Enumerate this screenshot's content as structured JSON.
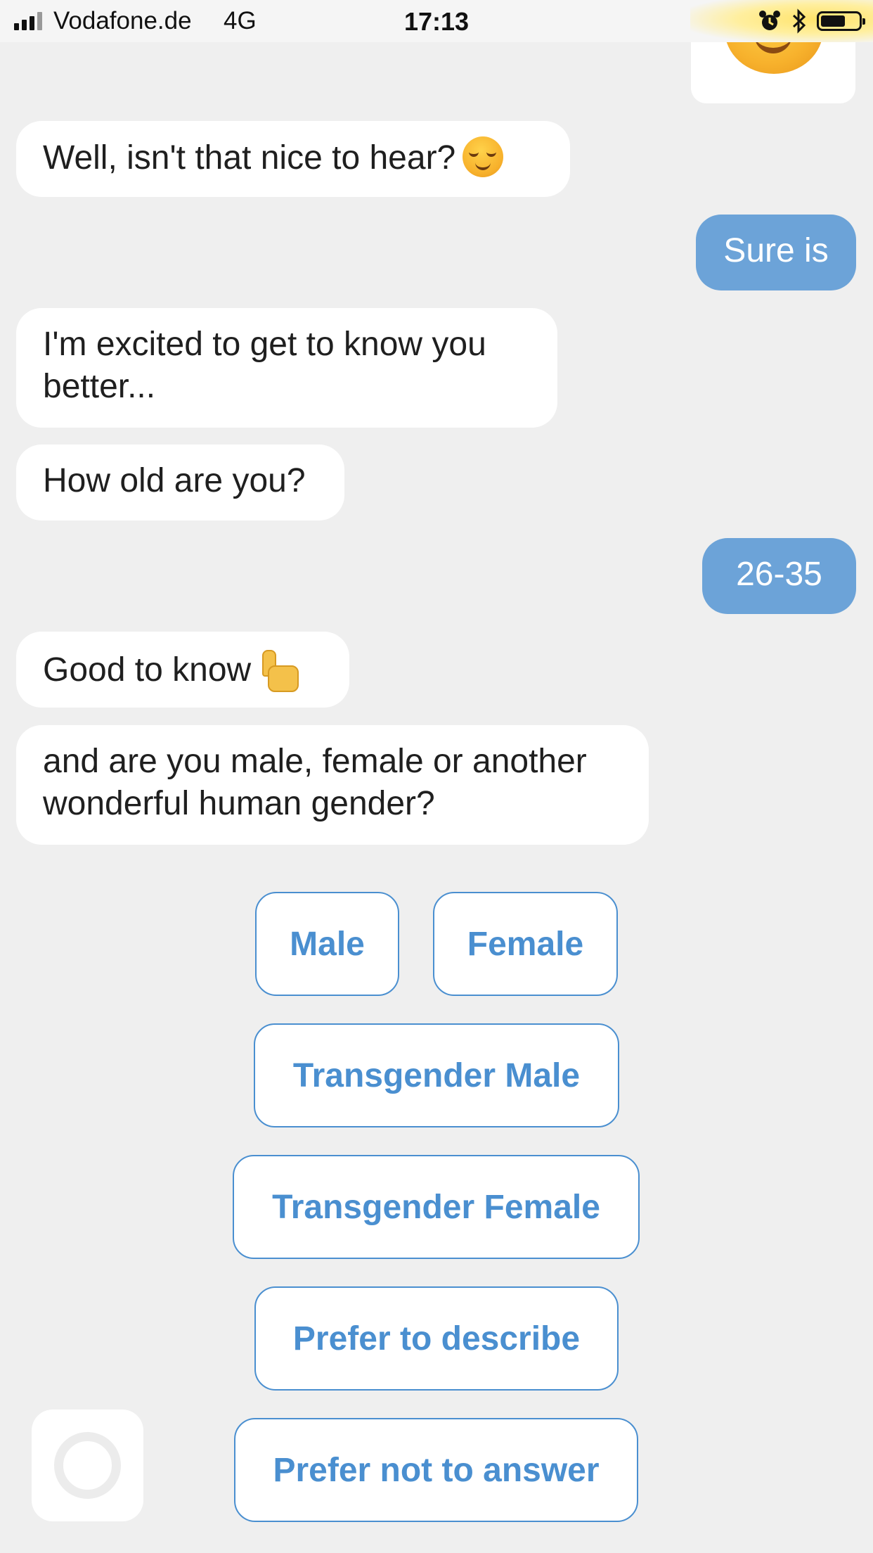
{
  "status_bar": {
    "carrier": "Vodafone.de",
    "network": "4G",
    "time": "17:13",
    "icons": [
      "signal-icon",
      "alarm-icon",
      "bluetooth-icon",
      "battery-icon"
    ]
  },
  "messages": [
    {
      "sender": "bot",
      "text": "Well, isn't that nice to hear?",
      "emoji": "relieved-face"
    },
    {
      "sender": "user",
      "text": "Sure is"
    },
    {
      "sender": "bot",
      "text": "I'm excited to get to know you better..."
    },
    {
      "sender": "bot",
      "text": "How old are you?"
    },
    {
      "sender": "user",
      "text": "26-35"
    },
    {
      "sender": "bot",
      "text": "Good to know",
      "emoji": "thumbs-up"
    },
    {
      "sender": "bot",
      "text": "and are you male, female or another wonderful human gender?"
    }
  ],
  "choices": [
    "Male",
    "Female",
    "Transgender Male",
    "Transgender Female",
    "Prefer to describe",
    "Prefer not to answer"
  ],
  "colors": {
    "background": "#efefef",
    "user_bubble": "#6ca3d8",
    "choice_accent": "#4a8fd0"
  }
}
